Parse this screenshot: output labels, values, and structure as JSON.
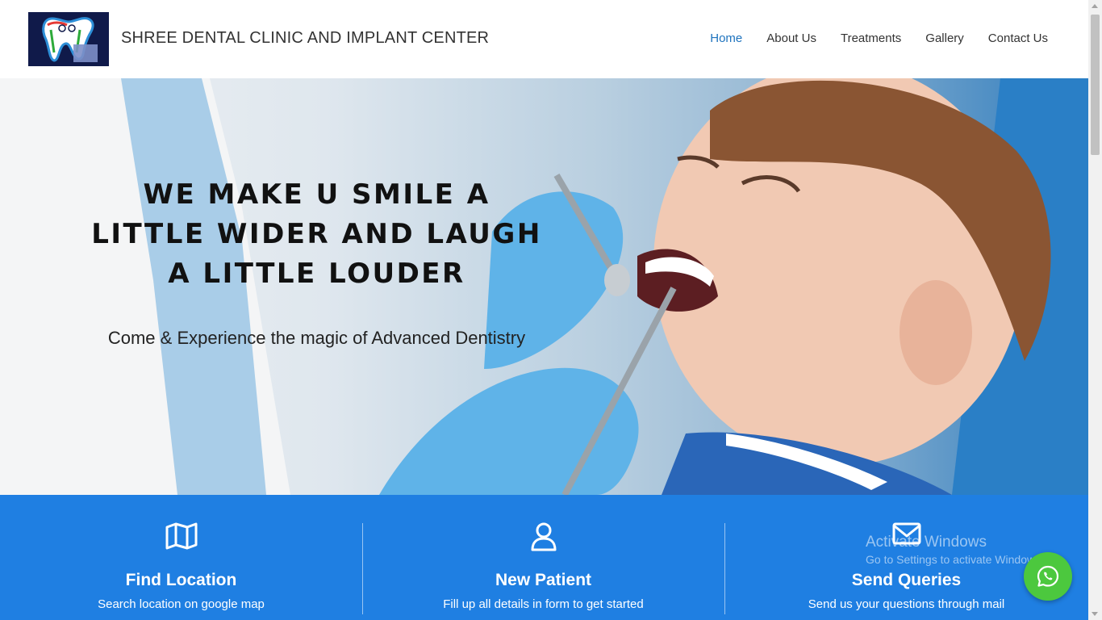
{
  "site": {
    "title": "SHREE DENTAL CLINIC AND IMPLANT CENTER",
    "logo_icon": "tooth-logo-icon"
  },
  "nav": {
    "items": [
      {
        "label": "Home",
        "active": true
      },
      {
        "label": "About Us",
        "active": false
      },
      {
        "label": "Treatments",
        "active": false
      },
      {
        "label": "Gallery",
        "active": false
      },
      {
        "label": "Contact Us",
        "active": false
      }
    ],
    "active_color": "#1e73be"
  },
  "hero": {
    "heading": "WE MAKE U SMILE A LITTLE WIDER AND LAUGH A LITTLE LOUDER",
    "subheading": "Come & Experience the magic of Advanced Dentistry"
  },
  "features": [
    {
      "icon": "map-icon",
      "title": "Find Location",
      "description": "Search location on google map"
    },
    {
      "icon": "user-icon",
      "title": "New Patient",
      "description": "Fill up all details in form to get started"
    },
    {
      "icon": "mail-icon",
      "title": "Send Queries",
      "description": "Send us your questions through mail"
    }
  ],
  "watermark": {
    "line1": "Activate Windows",
    "line2": "Go to Settings to activate Windows."
  },
  "whatsapp": {
    "icon": "whatsapp-icon",
    "color": "#4cc83e"
  },
  "colors": {
    "band": "#1f7fe2",
    "text_dark": "#333333"
  }
}
